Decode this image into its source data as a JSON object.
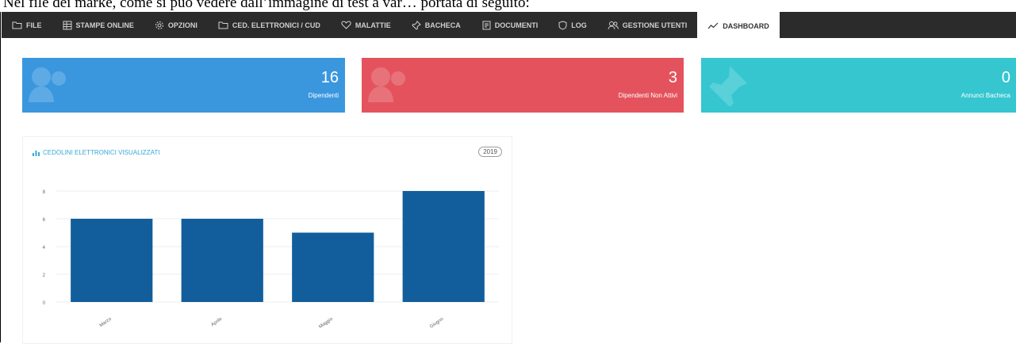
{
  "caption": "Nel file dei marke, come si può vedere dall’immagine di test a var… portata di seguito:",
  "nav": {
    "items": [
      {
        "label": "File",
        "icon": "folder-icon"
      },
      {
        "label": "Stampe Online",
        "icon": "grid-icon"
      },
      {
        "label": "Opzioni",
        "icon": "gear-icon"
      },
      {
        "label": "Ced. Elettronici / CUD",
        "icon": "folder-icon"
      },
      {
        "label": "Malattie",
        "icon": "heart-icon"
      },
      {
        "label": "Bacheca",
        "icon": "pin-icon"
      },
      {
        "label": "Documenti",
        "icon": "document-icon"
      },
      {
        "label": "Log",
        "icon": "shield-icon"
      },
      {
        "label": "Gestione Utenti",
        "icon": "users-icon"
      },
      {
        "label": "Dashboard",
        "icon": "chart-line-icon"
      }
    ],
    "active": "Dashboard"
  },
  "stats": {
    "dipendenti": {
      "value": "16",
      "label": "Dipendenti"
    },
    "non_attivi": {
      "value": "3",
      "label": "Dipendenti Non Attivi"
    },
    "annunci": {
      "value": "0",
      "label": "Annunci Bacheca"
    }
  },
  "colors": {
    "navbar": "#2b2b2b",
    "blue": "#3a97de",
    "red": "#e4535d",
    "cyan": "#35c6d0",
    "bar": "#125e9c",
    "title": "#33a9d8"
  },
  "panel": {
    "title": "Cedolini elettronici visualizzati",
    "year": "2019"
  },
  "chart_data": {
    "type": "bar",
    "categories": [
      "Marzo",
      "Aprile",
      "Maggio",
      "Giugno"
    ],
    "values": [
      6,
      6,
      5,
      8
    ],
    "ylim": [
      0,
      8
    ],
    "yticks": [
      "0",
      "2",
      "4",
      "6",
      "8"
    ],
    "grid": true,
    "title": "Cedolini elettronici visualizzati",
    "xlabel": "",
    "ylabel": ""
  }
}
